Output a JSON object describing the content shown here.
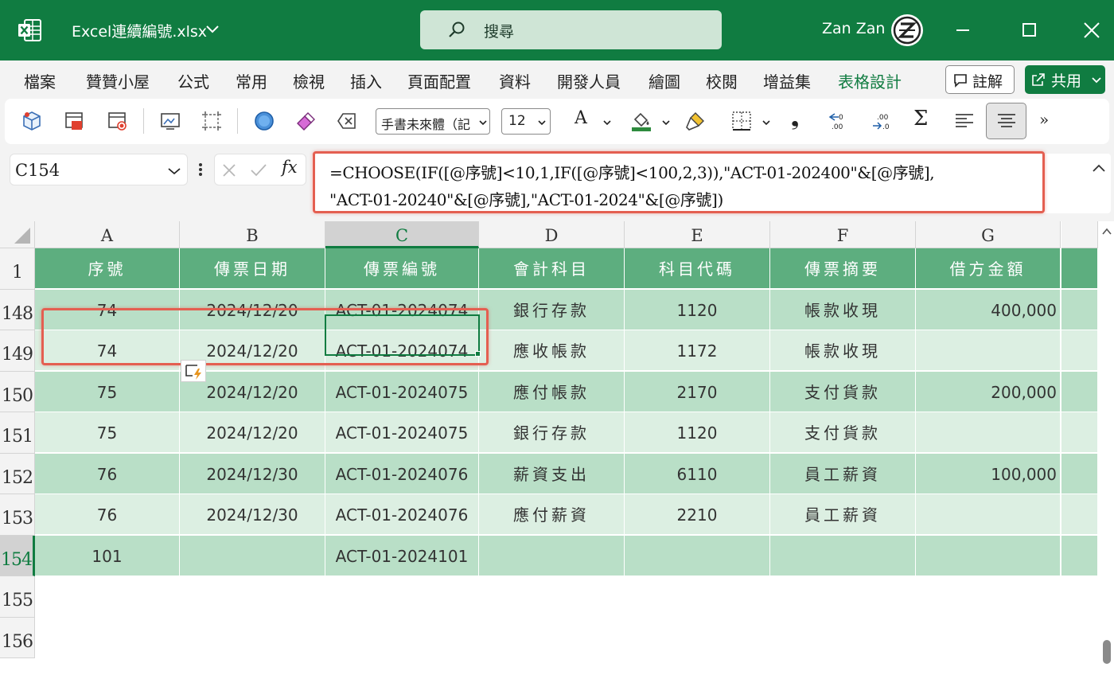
{
  "titlebar": {
    "filename": "Excel連續編號.xlsx",
    "search_label": "搜尋",
    "user_name": "Zan Zan"
  },
  "menu": {
    "tabs": [
      "檔案",
      "贊贊小屋",
      "公式",
      "常用",
      "檢視",
      "插入",
      "頁面配置",
      "資料",
      "開發人員",
      "繪圖",
      "校閱",
      "增益集",
      "表格設計"
    ],
    "active_tab": "表格設計",
    "comment_label": "註解",
    "share_label": "共用"
  },
  "toolbar": {
    "font_name": "手書未來體（記",
    "font_size": "12",
    "font_letter": "A",
    "comma_glyph": "❟",
    "sigma_glyph": "Σ",
    "more_glyph": "»"
  },
  "formula_bar": {
    "name_box": "C154",
    "fx_label": "fx",
    "formula_line1": "=CHOOSE(IF([@序號]<10,1,IF([@序號]<100,2,3)),\"ACT-01-202400\"&[@序號],",
    "formula_line2": "\"ACT-01-20240\"&[@序號],\"ACT-01-2024\"&[@序號])"
  },
  "sheet": {
    "columns": [
      "A",
      "B",
      "C",
      "D",
      "E",
      "F",
      "G"
    ],
    "selected_column": "C",
    "header_row_number": "1",
    "header_row": [
      "序號",
      "傳票日期",
      "傳票編號",
      "會計科目",
      "科目代碼",
      "傳票摘要",
      "借方金額"
    ],
    "rows": [
      {
        "num": "148",
        "cells": [
          "74",
          "2024/12/20",
          "ACT-01-2024074",
          "銀行存款",
          "1120",
          "帳款收現",
          "400,000"
        ]
      },
      {
        "num": "149",
        "cells": [
          "74",
          "2024/12/20",
          "ACT-01-2024074",
          "應收帳款",
          "1172",
          "帳款收現",
          ""
        ]
      },
      {
        "num": "150",
        "cells": [
          "75",
          "2024/12/20",
          "ACT-01-2024075",
          "應付帳款",
          "2170",
          "支付貨款",
          "200,000"
        ]
      },
      {
        "num": "151",
        "cells": [
          "75",
          "2024/12/20",
          "ACT-01-2024075",
          "銀行存款",
          "1120",
          "支付貨款",
          ""
        ]
      },
      {
        "num": "152",
        "cells": [
          "76",
          "2024/12/30",
          "ACT-01-2024076",
          "薪資支出",
          "6110",
          "員工薪資",
          "100,000"
        ]
      },
      {
        "num": "153",
        "cells": [
          "76",
          "2024/12/30",
          "ACT-01-2024076",
          "應付薪資",
          "2210",
          "員工薪資",
          ""
        ]
      },
      {
        "num": "154",
        "cells": [
          "101",
          "",
          "ACT-01-2024101",
          "",
          "",
          "",
          ""
        ]
      }
    ],
    "empty_rows": [
      "155",
      "156"
    ],
    "active_row": "154"
  },
  "colors": {
    "excel_green": "#107c41",
    "table_header": "#5dae7f",
    "band_dark": "#b9dfc7",
    "band_light": "#dcefe2",
    "highlight_red": "#e45f51"
  }
}
